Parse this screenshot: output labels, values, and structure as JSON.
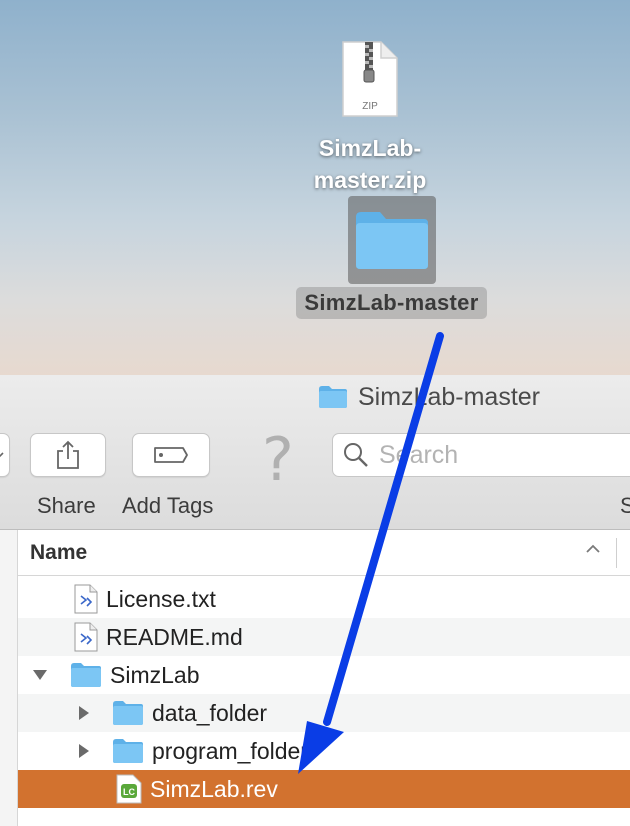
{
  "desktop": {
    "zip_file": {
      "icon_label": "ZIP",
      "label_line1": "SimzLab-",
      "label_line2": "master.zip"
    },
    "folder": {
      "label": "SimzLab-master"
    }
  },
  "window": {
    "title": "SimzLab-master"
  },
  "toolbar": {
    "share_label": "Share",
    "add_tags_label": "Add Tags",
    "right_label_partial": "S",
    "help_glyph": "?",
    "search_placeholder": "Search"
  },
  "list": {
    "column_name": "Name",
    "rows": [
      {
        "name": "License.txt",
        "type": "document"
      },
      {
        "name": "README.md",
        "type": "document"
      },
      {
        "name": "SimzLab",
        "type": "folder",
        "expanded": true
      },
      {
        "name": "data_folder",
        "type": "folder",
        "expanded": false
      },
      {
        "name": "program_folder",
        "type": "folder",
        "expanded": false
      },
      {
        "name": "SimzLab.rev",
        "type": "livecode-stack",
        "selected": true,
        "icon_text": "LC"
      }
    ]
  },
  "colors": {
    "selection": "#d2722f",
    "folder_blue": "#6cbcef",
    "arrow": "#0a3de6"
  }
}
